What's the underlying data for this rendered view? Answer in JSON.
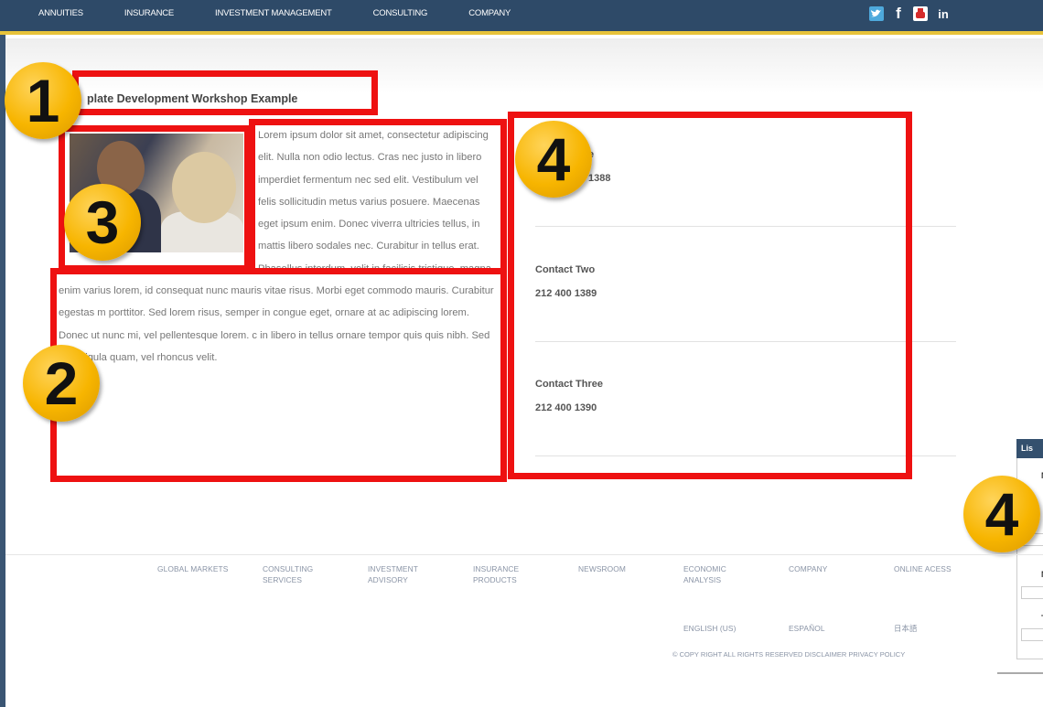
{
  "nav": {
    "items": [
      "ANNUITIES",
      "INSURANCE",
      "INVESTMENT MANAGEMENT",
      "CONSULTING",
      "COMPANY"
    ],
    "social": [
      "twitter-icon",
      "facebook-icon",
      "youtube-icon",
      "linkedin-icon"
    ],
    "fb_glyph": "f",
    "li_glyph": "in"
  },
  "page": {
    "title": "plate Development Workshop Example",
    "body": "Lorem ipsum dolor sit amet, consectetur adipiscing elit. Nulla non odio lectus. Cras nec justo in libero imperdiet fermentum nec sed elit. Vestibulum vel felis sollicitudin metus varius posuere. Maecenas eget ipsum enim. Donec viverra ultricies tellus, in mattis libero sodales nec. Curabitur in tellus erat. Phasellus interdum, velit in facilisis tristique, magna enim varius lorem, id consequat nunc mauris vitae risus. Morbi eget commodo mauris. Curabitur egestas m porttitor. Sed lorem risus, semper in congue eget, ornare at ac adipiscing lorem. Donec ut nunc mi, vel pellentesque lorem. c in libero in tellus ornare tempor quis quis nibh. Sed vitae ligula quam, vel rhoncus velit."
  },
  "contacts": [
    {
      "name": "e",
      "phone": "1388"
    },
    {
      "name": "Contact Two",
      "phone": "212 400 1389"
    },
    {
      "name": "Contact Three",
      "phone": "212 400 1390"
    }
  ],
  "annotations": {
    "badges": [
      "1",
      "2",
      "3",
      "4",
      "4"
    ],
    "colors": {
      "box": "#ee1111",
      "badge": "#f7b500"
    }
  },
  "side_widget": {
    "tab_label": "Lis",
    "letters": [
      "N",
      "N",
      "T"
    ]
  },
  "footer": {
    "links": [
      [
        "GLOBAL MARKETS",
        ""
      ],
      [
        "CONSULTING",
        "SERVICES"
      ],
      [
        "INVESTMENT",
        "ADVISORY"
      ],
      [
        "INSURANCE",
        "PRODUCTS"
      ],
      [
        "NEWSROOM",
        ""
      ],
      [
        "ECONOMIC",
        "ANALYSIS"
      ],
      [
        "COMPANY",
        ""
      ],
      [
        "ONLINE ACESS",
        ""
      ]
    ],
    "languages": [
      "ENGLISH (US)",
      "ESPAÑOL",
      "日本語"
    ],
    "legal": "© COPY RIGHT ALL RIGHTS RESERVED   DISCLAIMER   PRIVACY POLICY"
  },
  "colors": {
    "nav_bg": "#2e4a68",
    "nav_accent": "#e8c33a"
  }
}
